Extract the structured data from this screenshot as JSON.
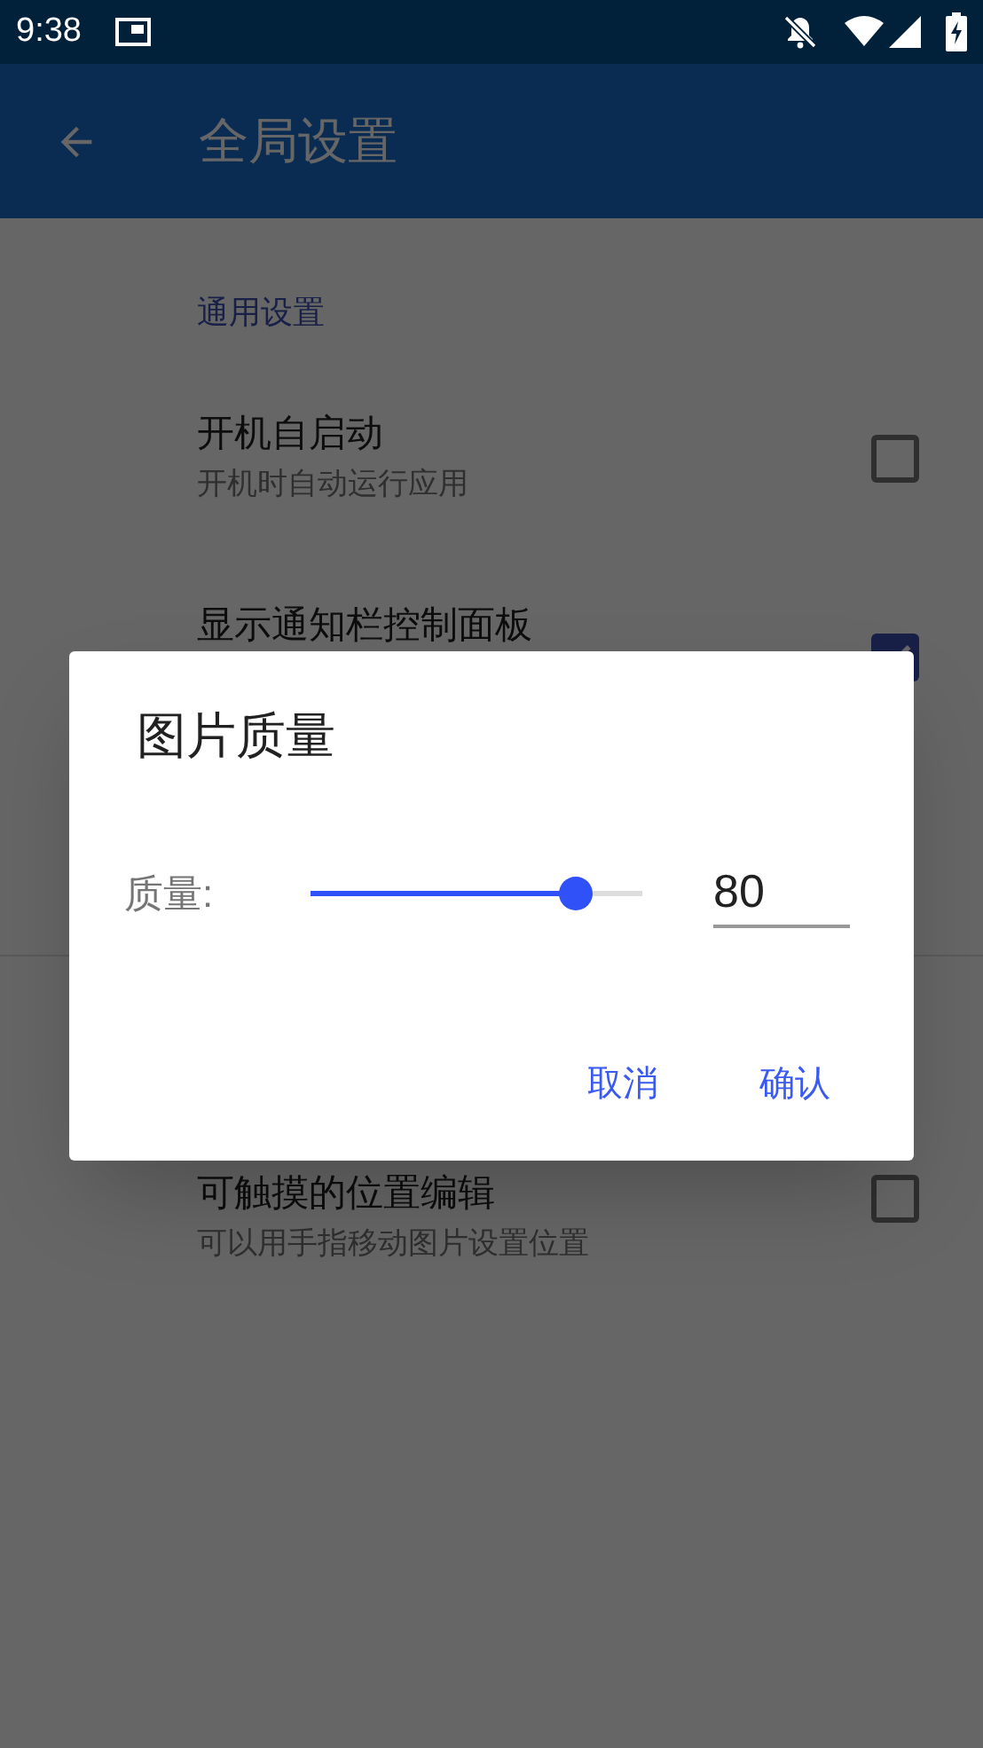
{
  "status_bar": {
    "time": "9:38"
  },
  "app_bar": {
    "title": "全局设置"
  },
  "sections": [
    {
      "header": "通用设置",
      "items": [
        {
          "title": "开机自启动",
          "subtitle": "开机时自动运行应用",
          "checked": false
        },
        {
          "title": "显示通知栏控制面板",
          "checked": true
        }
      ]
    },
    {
      "items": [
        {
          "title": "可触摸的位置编辑",
          "subtitle": "可以用手指移动图片设置位置",
          "checked": false
        }
      ]
    }
  ],
  "dialog": {
    "title": "图片质量",
    "label": "质量:",
    "slider": {
      "level": 0.8
    },
    "value": "80",
    "buttons": [
      "取消",
      "确认"
    ]
  }
}
